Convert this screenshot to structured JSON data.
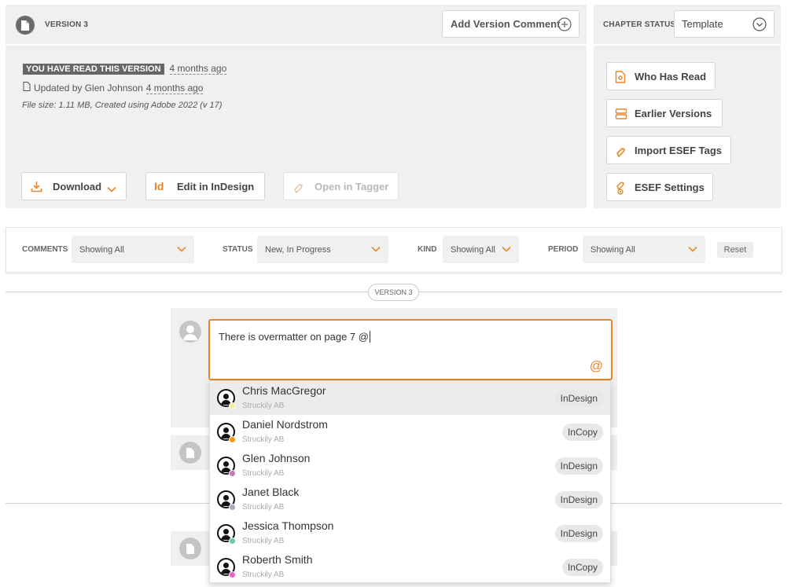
{
  "version_header": {
    "label": "VERSION 3",
    "add_comment_label": "Add Version Comment"
  },
  "chapter_status": {
    "label": "CHAPTER STATUS",
    "value": "Template"
  },
  "read_info": {
    "badge": "YOU HAVE READ THIS VERSION",
    "read_time": "4 months ago",
    "updated_prefix": "Updated by Glen Johnson",
    "updated_time": "4 months ago",
    "file_info": "File size: 1.11 MB, Created using Adobe 2022 (v 17)"
  },
  "actions": {
    "download": "Download",
    "edit_indesign": "Edit in InDesign",
    "indesign_icon_text": "Id",
    "open_tagger": "Open in Tagger"
  },
  "side_actions": {
    "who_has_read": "Who Has Read",
    "earlier_versions": "Earlier Versions",
    "import_esef": "Import ESEF Tags",
    "esef_settings": "ESEF Settings"
  },
  "filters": {
    "comments_label": "COMMENTS",
    "comments_value": "Showing All",
    "status_label": "STATUS",
    "status_value": "New, In Progress",
    "kind_label": "KIND",
    "kind_value": "Showing All",
    "period_label": "PERIOD",
    "period_value": "Showing All",
    "reset": "Reset"
  },
  "version_divider": "VERSION 3",
  "comment_input": {
    "value": "There is overmatter on page 7 @"
  },
  "mention_list": [
    {
      "name": "Chris MacGregor",
      "company": "Struckily AB",
      "role": "InDesign",
      "status_color": "#f5f0a0"
    },
    {
      "name": "Daniel Nordstrom",
      "company": "Struckily AB",
      "role": "InCopy",
      "status_color": "#f39c12"
    },
    {
      "name": "Glen Johnson",
      "company": "Struckily AB",
      "role": "InDesign",
      "status_color": "#c27bb8"
    },
    {
      "name": "Janet Black",
      "company": "Struckily AB",
      "role": "InDesign",
      "status_color": "#a9a9b8"
    },
    {
      "name": "Jessica Thompson",
      "company": "Struckily AB",
      "role": "InDesign",
      "status_color": "#6cc6b5"
    },
    {
      "name": "Roberth Smith",
      "company": "Struckily AB",
      "role": "InCopy",
      "status_color": "#e861c9"
    }
  ],
  "colors": {
    "accent": "#e8872b",
    "panel": "#f0f0f0"
  }
}
